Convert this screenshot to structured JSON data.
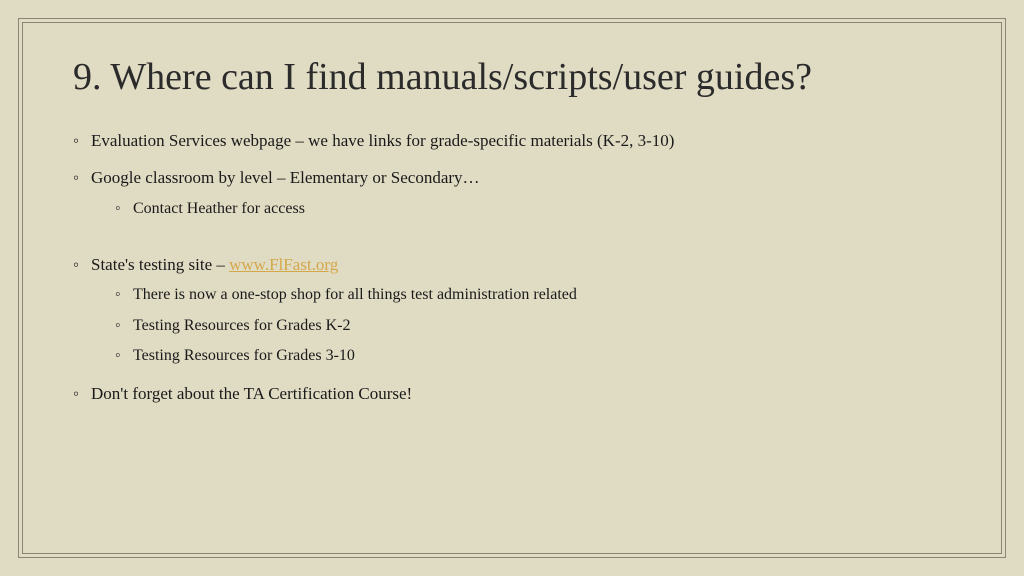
{
  "title": "9.  Where can I find manuals/scripts/user guides?",
  "bullets": {
    "b1": "Evaluation Services webpage – we have links for grade-specific materials (K-2, 3-10)",
    "b2": "Google classroom by level – Elementary or Secondary…",
    "b2_sub1": "Contact Heather for access",
    "b3_prefix": "State's testing site – ",
    "b3_link": "www.FlFast.org",
    "b3_sub1": "There is now a one-stop shop for all things test administration related",
    "b3_sub2": "Testing Resources for Grades K-2",
    "b3_sub3": "Testing Resources for Grades 3-10",
    "b4": "Don't forget about the TA Certification Course!"
  }
}
